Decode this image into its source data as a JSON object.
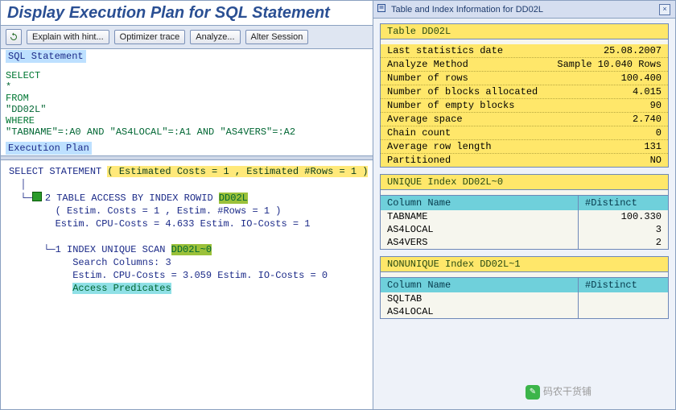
{
  "header": {
    "title": "Display Execution Plan for SQL Statement"
  },
  "toolbar": {
    "explain": "Explain with hint...",
    "optimizer": "Optimizer trace",
    "analyze": "Analyze...",
    "alter": "Alter Session"
  },
  "sql": {
    "section_label": "SQL Statement",
    "lines": {
      "select": "SELECT",
      "star": "  *",
      "from": "FROM",
      "table": "  \"DD02L\"",
      "where": "WHERE",
      "cond": "  \"TABNAME\"=:A0 AND \"AS4LOCAL\"=:A1 AND \"AS4VERS\"=:A2"
    }
  },
  "plan": {
    "section_label": "Execution Plan",
    "root_label": "SELECT STATEMENT",
    "root_est": "( Estimated Costs = 1 , Estimated #Rows = 1 )",
    "node1_prefix": "2 TABLE ACCESS BY INDEX ROWID",
    "node1_obj": "DD02L",
    "node1_l1": "( Estim. Costs = 1 , Estim. #Rows = 1 )",
    "node1_l2": "Estim. CPU-Costs = 4.633 Estim. IO-Costs = 1",
    "node2_prefix": "1 INDEX UNIQUE SCAN",
    "node2_obj": "DD02L~0",
    "node2_l1": "Search Columns: 3",
    "node2_l2": "Estim. CPU-Costs = 3.059 Estim. IO-Costs = 0",
    "node2_l3": "Access Predicates"
  },
  "right": {
    "title": "Table and Index Information for DD02L",
    "table_block": {
      "title": "Table   DD02L",
      "rows": [
        {
          "label": "Last statistics date",
          "value": "25.08.2007"
        },
        {
          "label": "Analyze Method",
          "value": "Sample 10.040 Rows"
        },
        {
          "label": "Number of rows",
          "value": "100.400"
        },
        {
          "label": "Number of blocks allocated",
          "value": "4.015"
        },
        {
          "label": "Number of empty blocks",
          "value": "90"
        },
        {
          "label": "Average space",
          "value": "2.740"
        },
        {
          "label": "Chain count",
          "value": "0"
        },
        {
          "label": "Average row length",
          "value": "131"
        },
        {
          "label": "Partitioned",
          "value": "NO"
        }
      ]
    },
    "idx0": {
      "title": "UNIQUE    Index   DD02L~0",
      "col1": "Column Name",
      "col2": "#Distinct",
      "rows": [
        {
          "name": "TABNAME",
          "dist": "100.330"
        },
        {
          "name": "AS4LOCAL",
          "dist": "3"
        },
        {
          "name": "AS4VERS",
          "dist": "2"
        }
      ]
    },
    "idx1": {
      "title": "NONUNIQUE  Index   DD02L~1",
      "col1": "Column Name",
      "col2": "#Distinct",
      "rows": [
        {
          "name": "SQLTAB",
          "dist": ""
        },
        {
          "name": "AS4LOCAL",
          "dist": ""
        }
      ]
    }
  },
  "watermark": "码农干货铺"
}
